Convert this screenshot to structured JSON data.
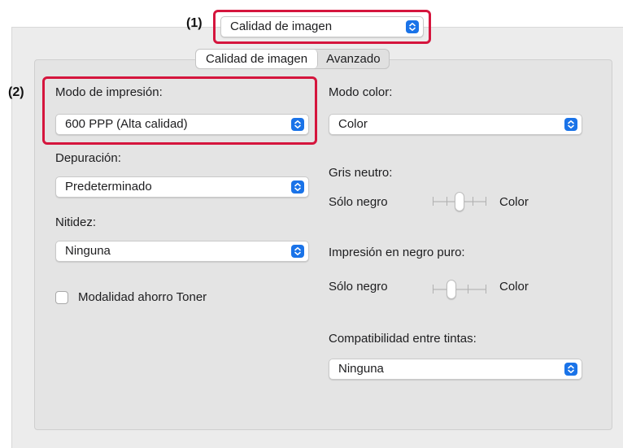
{
  "callouts": {
    "one": "(1)",
    "two": "(2)"
  },
  "top_menu": {
    "value": "Calidad de imagen"
  },
  "tabs": {
    "active": "Calidad de imagen",
    "inactive": "Avanzado"
  },
  "left": {
    "print_mode_label": "Modo de impresión:",
    "print_mode_value": "600 PPP (Alta calidad)",
    "debug_label": "Depuración:",
    "debug_value": "Predeterminado",
    "sharpness_label": "Nitidez:",
    "sharpness_value": "Ninguna",
    "toner_save_label": "Modalidad ahorro Toner",
    "toner_save_checked": false
  },
  "right": {
    "color_mode_label": "Modo color:",
    "color_mode_value": "Color",
    "neutral_gray_label": "Gris neutro:",
    "neutral_gray_left": "Sólo negro",
    "neutral_gray_right": "Color",
    "neutral_gray_level": 0.5,
    "pure_black_label": "Impresión en negro puro:",
    "pure_black_left": "Sólo negro",
    "pure_black_right": "Color",
    "pure_black_level": 0.33,
    "ink_compat_label": "Compatibilidad entre tintas:",
    "ink_compat_value": "Ninguna"
  },
  "colors": {
    "callout": "#d5153d",
    "popup_arrow": "#1a73e8"
  },
  "icons": {
    "popup_arrow": "up-down-chevron-icon"
  }
}
